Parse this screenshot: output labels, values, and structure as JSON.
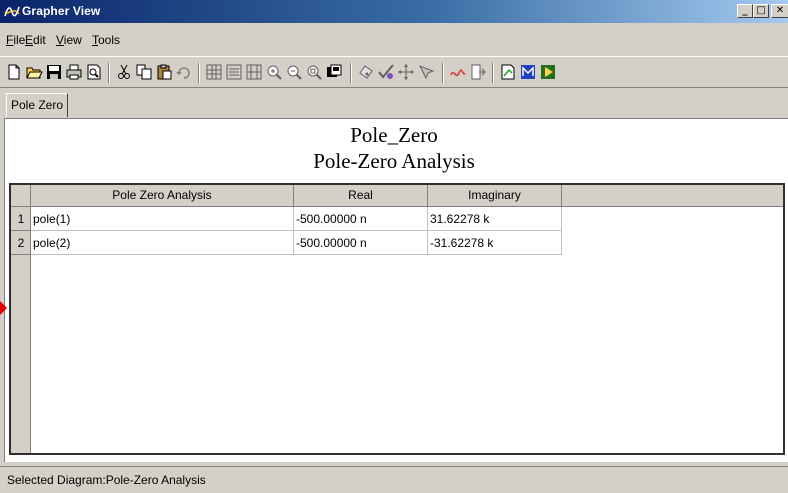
{
  "window": {
    "title": "Grapher View",
    "title_bar_gradient": [
      "#0a246a",
      "#a6caf0"
    ]
  },
  "caption_buttons": {
    "minimize": "_",
    "maximize": "□",
    "close": "✕"
  },
  "menu": [
    "File",
    "Edit",
    "View",
    "Tools"
  ],
  "toolbar": {
    "icons": [
      "new-document-icon",
      "open-folder-icon",
      "save-icon",
      "print-icon",
      "print-preview-icon",
      "cut-icon",
      "copy-icon",
      "paste-icon",
      "undo-icon",
      "toggle-grid-icon",
      "toggle-legend-icon",
      "toggle-cursors-icon",
      "zoom-in-icon",
      "zoom-out-icon",
      "zoom-fit-icon",
      "overlay-plots-icon",
      "select-traces-icon",
      "check-marks-icon",
      "move-cursor-icon",
      "cursor-tools-icon",
      "add-trace-icon",
      "export-icon",
      "properties-icon",
      "mathcad-export-icon",
      "run-icon"
    ]
  },
  "tab": {
    "label": "Pole Zero"
  },
  "document": {
    "title": "Pole_Zero",
    "subtitle": "Pole-Zero Analysis"
  },
  "table": {
    "headers": [
      "Pole Zero Analysis",
      "Real",
      "Imaginary"
    ],
    "rows": [
      {
        "n": "1",
        "name": "pole(1)",
        "real": "-500.00000 n",
        "imag": "31.62278 k"
      },
      {
        "n": "2",
        "name": "pole(2)",
        "real": "-500.00000 n",
        "imag": "-31.62278 k"
      }
    ]
  },
  "status": {
    "text": "Selected Diagram:Pole-Zero Analysis"
  },
  "colors": {
    "chrome": "#d4d0c8",
    "marker": "#e00000"
  }
}
